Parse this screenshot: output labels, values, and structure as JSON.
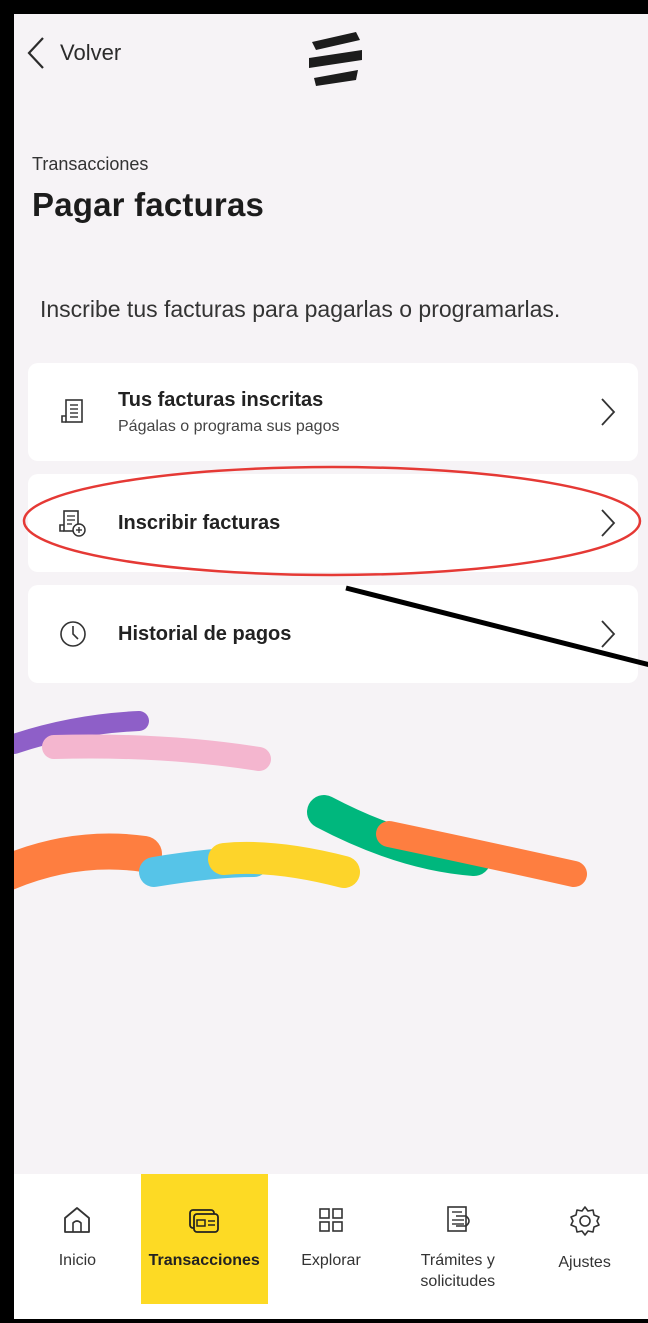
{
  "header": {
    "back_label": "Volver",
    "logo_icon": "bank-logo-icon"
  },
  "page": {
    "breadcrumb": "Transacciones",
    "title": "Pagar facturas",
    "description": "Inscribe tus facturas para pagarlas o programarlas."
  },
  "options": [
    {
      "label": "Tus facturas inscritas",
      "sublabel": "Págalas o programa sus pagos",
      "icon": "invoice-icon"
    },
    {
      "label": "Inscribir facturas",
      "sublabel": "",
      "icon": "invoice-add-icon"
    },
    {
      "label": "Historial de pagos",
      "sublabel": "",
      "icon": "clock-icon"
    }
  ],
  "bottom_nav": [
    {
      "label": "Inicio",
      "icon": "home-icon"
    },
    {
      "label": "Transacciones",
      "icon": "card-icon",
      "active": true
    },
    {
      "label": "Explorar",
      "icon": "grid-icon"
    },
    {
      "label": "Trámites y solicitudes",
      "icon": "document-icon"
    },
    {
      "label": "Ajustes",
      "icon": "gear-icon"
    }
  ],
  "colors": {
    "accent": "#fdda24",
    "annotation": "#e53935",
    "background": "#f6f3f6"
  }
}
